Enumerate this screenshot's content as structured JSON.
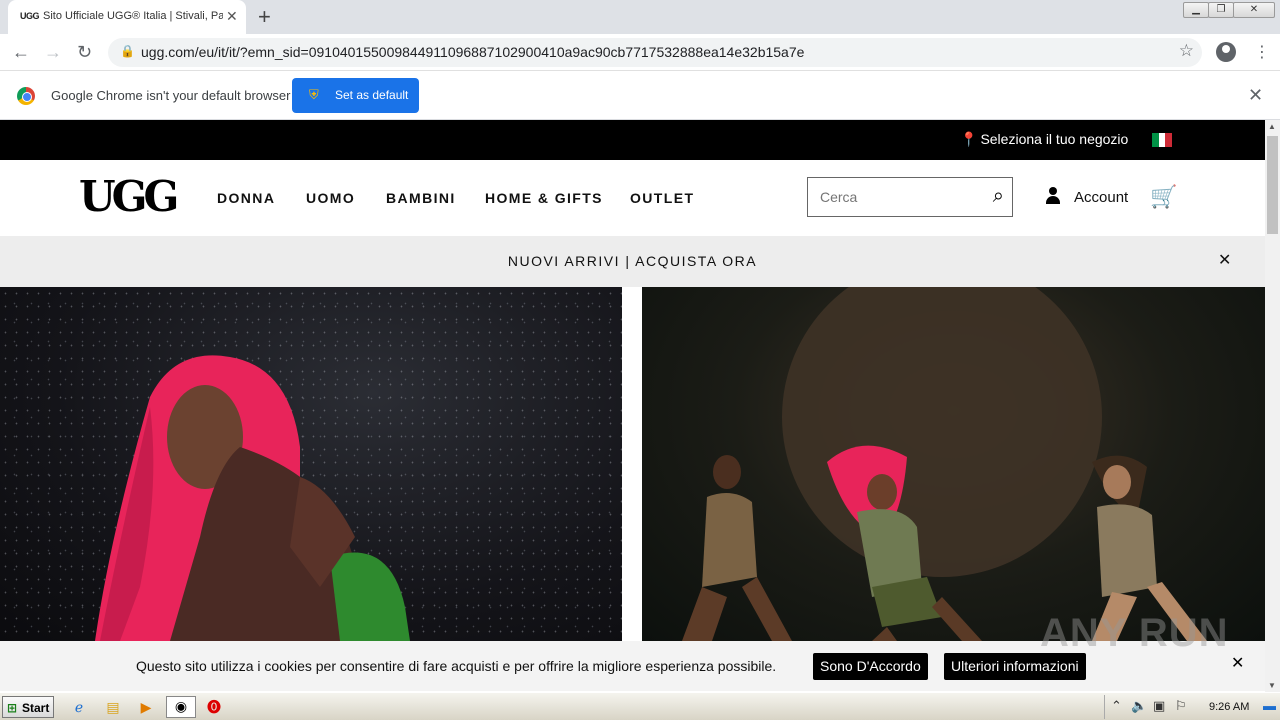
{
  "browser": {
    "tab_title": "Sito Ufficiale UGG® Italia | Stivali, Pa",
    "tab_favicon": "UGG",
    "url": "ugg.com/eu/it/it/?emn_sid=091040155009844911096887102900410a9ac90cb7717532888ea14e32b15a7e",
    "infobar_message": "Google Chrome isn't your default browser",
    "set_default_label": "Set as default"
  },
  "site": {
    "store_label": "Seleziona il tuo negozio",
    "logo": "UGG",
    "nav": [
      "DONNA",
      "UOMO",
      "BAMBINI",
      "HOME & GIFTS",
      "OUTLET"
    ],
    "search_placeholder": "Cerca",
    "account_label": "Account",
    "promo_text": "NUOVI ARRIVI | ACQUISTA ORA"
  },
  "cookie": {
    "message": "Questo sito utilizza i cookies per consentire di fare acquisti e per offrire la migliore esperienza possibile.",
    "accept_label": "Sono D'Accordo",
    "info_label": "Ulteriori informazioni"
  },
  "watermark": "ANY RUN",
  "taskbar": {
    "start_label": "Start",
    "clock": "9:26 AM"
  },
  "colors": {
    "chrome_blue": "#1a73e8",
    "ugg_black": "#000000",
    "promo_bg": "#ededed",
    "flag_green": "#009246",
    "flag_white": "#ffffff",
    "flag_red": "#ce2b37",
    "hair_pink": "#e8245a"
  },
  "icons": [
    "back-icon",
    "forward-icon",
    "reload-icon",
    "lock-icon",
    "star-icon",
    "profile-icon",
    "menu-icon",
    "chrome-logo-icon",
    "shield-icon",
    "close-icon",
    "location-pin-icon",
    "italy-flag-icon",
    "search-icon",
    "user-icon",
    "cart-icon"
  ]
}
